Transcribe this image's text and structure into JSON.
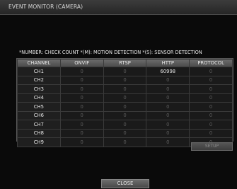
{
  "window": {
    "title": "EVENT MONITOR (CAMERA)"
  },
  "legend": "*NUMBER: CHECK COUNT  *(M): MOTION DETECTION  *(S): SENSOR DETECTION",
  "table": {
    "headers": [
      "CHANNEL",
      "ONVIF",
      "RTSP",
      "HTTP",
      "PROTOCOL"
    ],
    "rows": [
      {
        "channel": "CH1",
        "onvif": "0",
        "rtsp": "0",
        "http": "60998",
        "protocol": "0"
      },
      {
        "channel": "CH2",
        "onvif": "0",
        "rtsp": "0",
        "http": "0",
        "protocol": "0"
      },
      {
        "channel": "CH3",
        "onvif": "0",
        "rtsp": "0",
        "http": "0",
        "protocol": "0"
      },
      {
        "channel": "CH4",
        "onvif": "0",
        "rtsp": "0",
        "http": "0",
        "protocol": "0"
      },
      {
        "channel": "CH5",
        "onvif": "0",
        "rtsp": "0",
        "http": "0",
        "protocol": "0"
      },
      {
        "channel": "CH6",
        "onvif": "0",
        "rtsp": "0",
        "http": "0",
        "protocol": "0"
      },
      {
        "channel": "CH7",
        "onvif": "0",
        "rtsp": "0",
        "http": "0",
        "protocol": "0"
      },
      {
        "channel": "CH8",
        "onvif": "0",
        "rtsp": "0",
        "http": "0",
        "protocol": "0"
      },
      {
        "channel": "CH9",
        "onvif": "0",
        "rtsp": "0",
        "http": "0",
        "protocol": "0"
      }
    ]
  },
  "buttons": {
    "setup": "SETUP",
    "close": "CLOSE"
  }
}
